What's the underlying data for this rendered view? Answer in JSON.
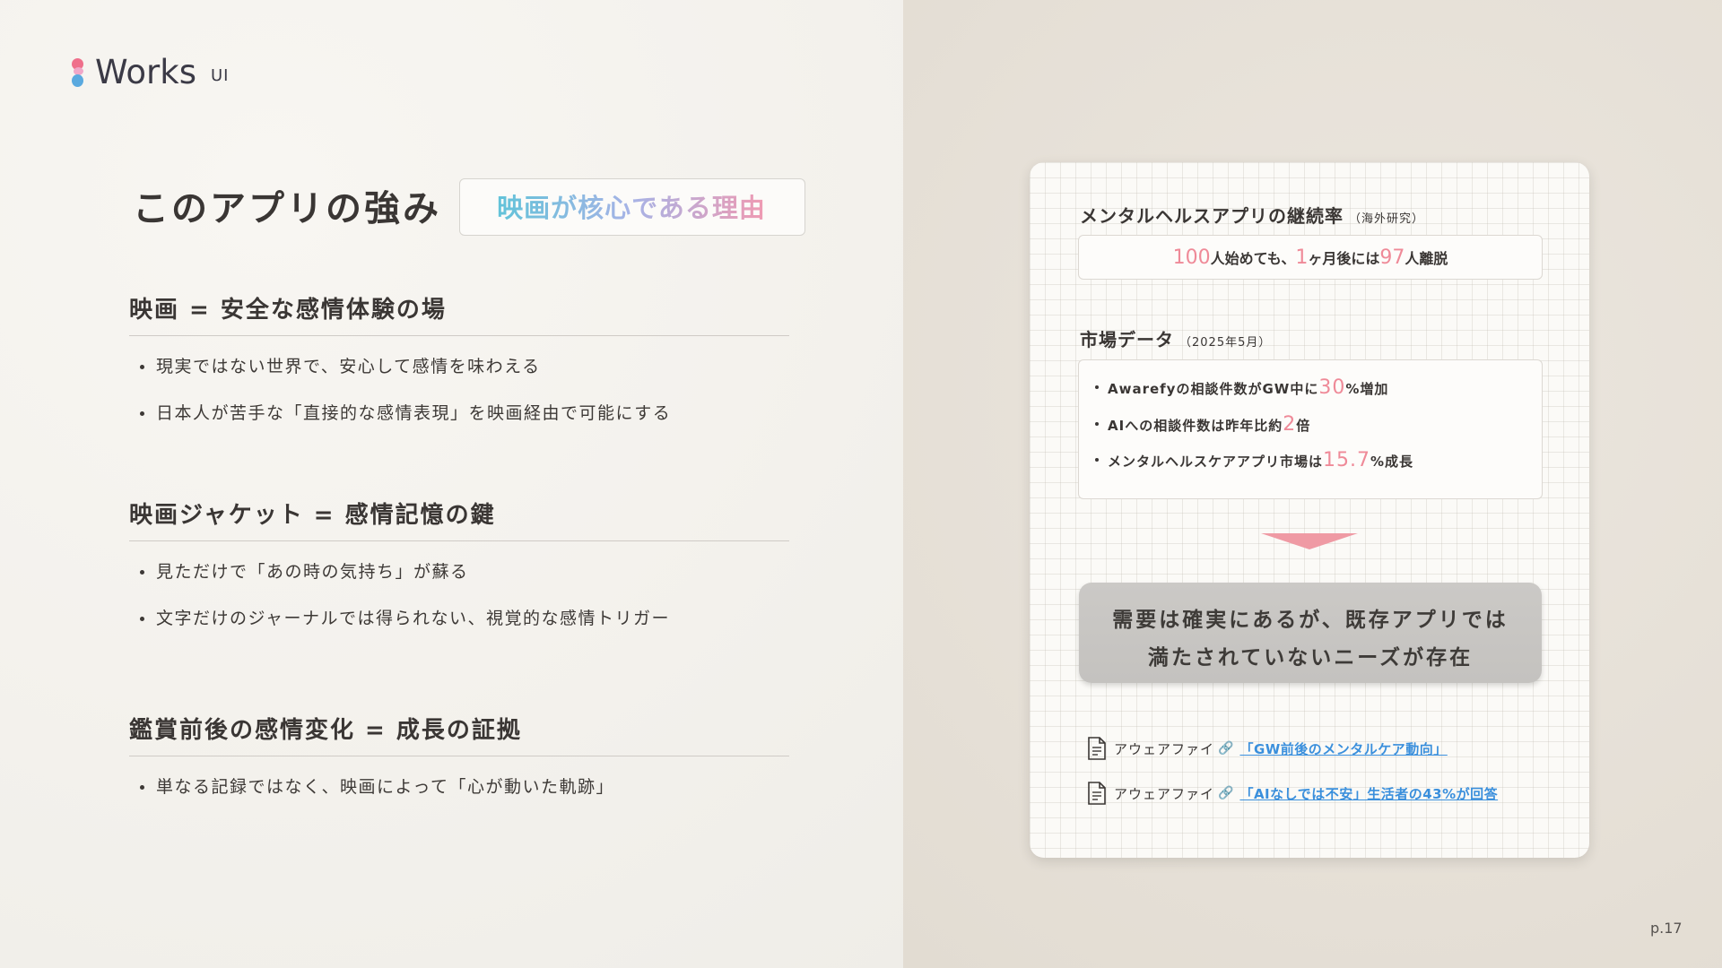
{
  "logo": {
    "text": "Works",
    "sub": "UI"
  },
  "title": {
    "main": "このアプリの強み",
    "badge": "映画が核心である理由"
  },
  "sections": [
    {
      "heading": "映画 = 安全な感情体験の場",
      "bullets": [
        "現実ではない世界で、安心して感情を味わえる",
        "日本人が苦手な「直接的な感情表現」を映画経由で可能にする"
      ]
    },
    {
      "heading": "映画ジャケット = 感情記憶の鍵",
      "bullets": [
        "見ただけで「あの時の気持ち」が蘇る",
        "文字だけのジャーナルでは得られない、視覚的な感情トリガー"
      ]
    },
    {
      "heading": "鑑賞前後の感情変化 = 成長の証拠",
      "bullets": [
        "単なる記録ではなく、映画によって「心が動いた軌跡」"
      ]
    }
  ],
  "card": {
    "retention": {
      "heading": "メンタルヘルスアプリの継続率",
      "heading_sub": "（海外研究）",
      "n1": "100",
      "t1": "人始めても、",
      "n2": "1",
      "t2": "ヶ月後には",
      "n3": "97",
      "t3": "人離脱"
    },
    "market": {
      "heading": "市場データ",
      "heading_sub": "（2025年5月）",
      "items": [
        {
          "pre": "Awarefyの相談件数がGW中に",
          "num": "30",
          "post": "%増加"
        },
        {
          "pre": "AIへの相談件数は昨年比約",
          "num": "2",
          "post": "倍"
        },
        {
          "pre": "メンタルヘルスケアアプリ市場は",
          "num": "15.7",
          "post": "%成長"
        }
      ]
    },
    "conclusion": {
      "line1": "需要は確実にあるが、既存アプリでは",
      "line2": "満たされていないニーズが存在"
    },
    "refs": [
      {
        "source": "アウェアファイ",
        "link": "「GW前後のメンタルケア動向」"
      },
      {
        "source": "アウェアファイ",
        "link": "「AIなしでは不安」生活者の43%が回答"
      }
    ]
  },
  "page": "p.17",
  "colors": {
    "accent_pink": "#ef8a98",
    "link_blue": "#3a8fdc",
    "badge_gradient": [
      "#62c3d9",
      "#a7b3e6",
      "#f09ab2"
    ]
  },
  "icons": [
    "document-icon",
    "link-icon",
    "down-arrow-icon"
  ]
}
